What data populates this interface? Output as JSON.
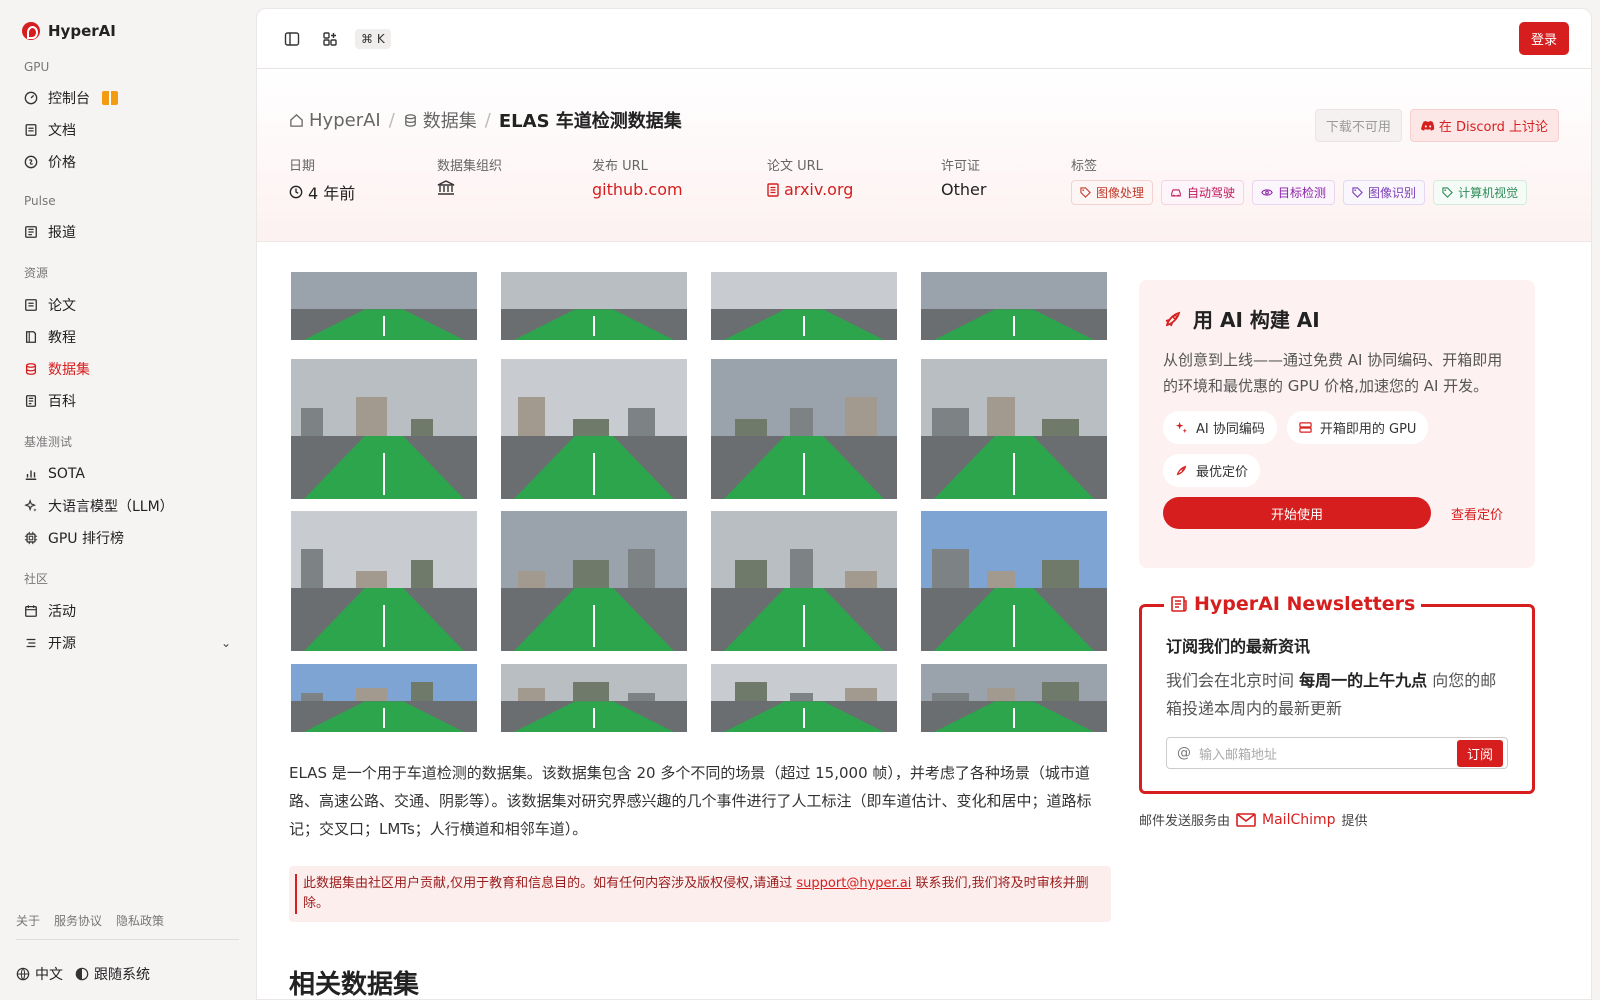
{
  "sidebar": {
    "brand": "HyperAI",
    "sections": [
      {
        "label": "GPU",
        "items": [
          {
            "label": "控制台",
            "icon": "gauge-icon",
            "gift": true
          },
          {
            "label": "文档",
            "icon": "doc-icon"
          },
          {
            "label": "价格",
            "icon": "price-icon"
          }
        ]
      },
      {
        "label": "Pulse",
        "items": [
          {
            "label": "报道",
            "icon": "news-icon"
          }
        ]
      },
      {
        "label": "资源",
        "items": [
          {
            "label": "论文",
            "icon": "paper-icon"
          },
          {
            "label": "教程",
            "icon": "book-icon"
          },
          {
            "label": "数据集",
            "icon": "database-icon",
            "active": true
          },
          {
            "label": "百科",
            "icon": "wiki-icon"
          }
        ]
      },
      {
        "label": "基准测试",
        "items": [
          {
            "label": "SOTA",
            "icon": "chart-icon"
          },
          {
            "label": "大语言模型（LLM）",
            "icon": "sparkle-icon"
          },
          {
            "label": "GPU 排行榜",
            "icon": "cpu-icon"
          }
        ]
      },
      {
        "label": "社区",
        "items": [
          {
            "label": "活动",
            "icon": "calendar-icon"
          },
          {
            "label": "开源",
            "icon": "list-icon",
            "expand": true
          }
        ]
      }
    ],
    "footer_links": [
      "关于",
      "服务协议",
      "隐私政策"
    ],
    "language": "中文",
    "theme": "跟随系统"
  },
  "topbar": {
    "shortcut": "⌘ K",
    "login": "登录"
  },
  "breadcrumb": {
    "home": "HyperAI",
    "section": "数据集",
    "current": "ELAS 车道检测数据集"
  },
  "actions": {
    "download": "下载不可用",
    "discord": "在 Discord 上讨论"
  },
  "meta": {
    "date_label": "日期",
    "date_value": "4 年前",
    "org_label": "数据集组织",
    "url_label": "发布 URL",
    "url_value": "github.com",
    "paper_label": "论文 URL",
    "paper_value": "arxiv.org",
    "license_label": "许可证",
    "license_value": "Other",
    "tags_label": "标签",
    "tags": [
      {
        "label": "图像处理",
        "color": "#c0392b"
      },
      {
        "label": "自动驾驶",
        "color": "#c2185b"
      },
      {
        "label": "目标检测",
        "color": "#8e24aa"
      },
      {
        "label": "图像识别",
        "color": "#7b3fb5"
      },
      {
        "label": "计算机视觉",
        "color": "#2e8b57"
      }
    ]
  },
  "description": "ELAS 是一个用于车道检测的数据集。该数据集包含 20 多个不同的场景（超过 15,000 帧），并考虑了各种场景（城市道路、高速公路、交通、阴影等）。该数据集对研究界感兴趣的几个事件进行了人工标注（即车道估计、变化和居中；道路标记；交叉口；LMTs；人行横道和相邻车道）。",
  "notice": {
    "before": "此数据集由社区用户贡献,仅用于教育和信息目的。如有任何内容涉及版权侵权,请通过 ",
    "email": "support@hyper.ai",
    "after": " 联系我们,我们将及时审核并删除。"
  },
  "related_title": "相关数据集",
  "promo": {
    "title": "用 AI 构建 AI",
    "text": "从创意到上线——通过免费 AI 协同编码、开箱即用的环境和最优惠的 GPU 价格,加速您的 AI 开发。",
    "pills": [
      "AI 协同编码",
      "开箱即用的 GPU",
      "最优定价"
    ],
    "start": "开始使用",
    "pricing": "查看定价"
  },
  "newsletter": {
    "legend": "HyperAI Newsletters",
    "subtitle": "订阅我们的最新资讯",
    "text_before": "我们会在北京时间 ",
    "text_bold": "每周一的上午九点",
    "text_after": " 向您的邮箱投递本周内的最新更新",
    "placeholder": "输入邮箱地址",
    "subscribe": "订阅"
  },
  "mailchimp": {
    "before": "邮件发送服务由",
    "brand": "MailChimp",
    "after": "提供"
  },
  "colors": {
    "accent": "#d71e1e",
    "lane": "#29a84a"
  }
}
